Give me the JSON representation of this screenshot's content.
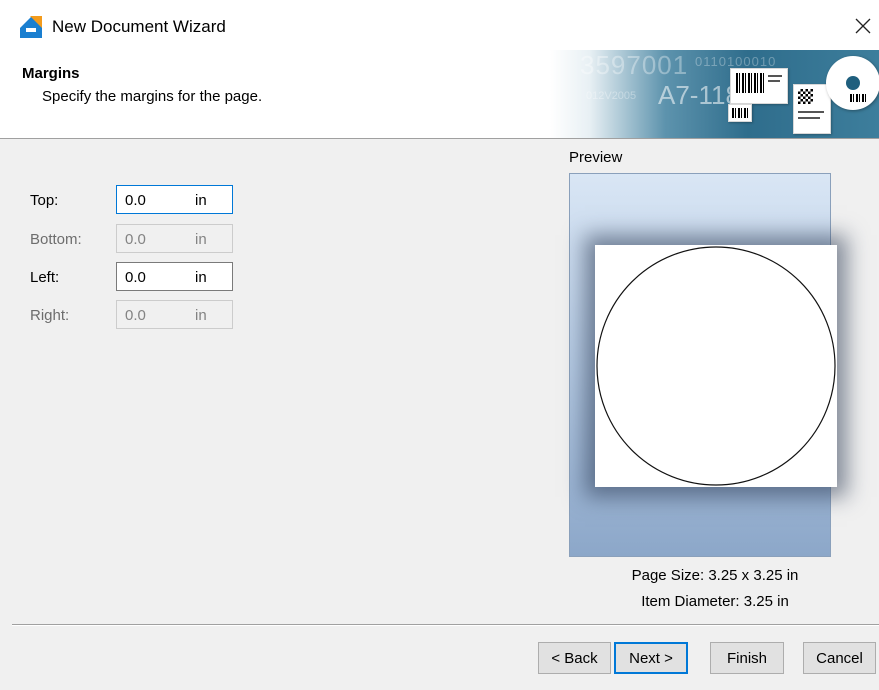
{
  "window": {
    "title": "New Document Wizard"
  },
  "header": {
    "title": "Margins",
    "subtitle": "Specify the margins for the page."
  },
  "banner": {
    "number1": "3597001",
    "binary": "0110100010",
    "number2": "A7-118",
    "small_text": "012V2005"
  },
  "margins": {
    "top": {
      "label": "Top:",
      "value": "0.0",
      "unit": "in",
      "enabled": true
    },
    "bottom": {
      "label": "Bottom:",
      "value": "0.0",
      "unit": "in",
      "enabled": false
    },
    "left": {
      "label": "Left:",
      "value": "0.0",
      "unit": "in",
      "enabled": true
    },
    "right": {
      "label": "Right:",
      "value": "0.0",
      "unit": "in",
      "enabled": false
    }
  },
  "preview": {
    "label": "Preview",
    "page_size": "Page Size:  3.25 x 3.25 in",
    "item_diameter": "Item Diameter:  3.25 in"
  },
  "buttons": {
    "back": "< Back",
    "next": "Next >",
    "finish": "Finish",
    "cancel": "Cancel"
  },
  "colors": {
    "accent": "#0078d7",
    "icon_blue": "#1a7fd0",
    "icon_orange": "#f39b1c"
  }
}
